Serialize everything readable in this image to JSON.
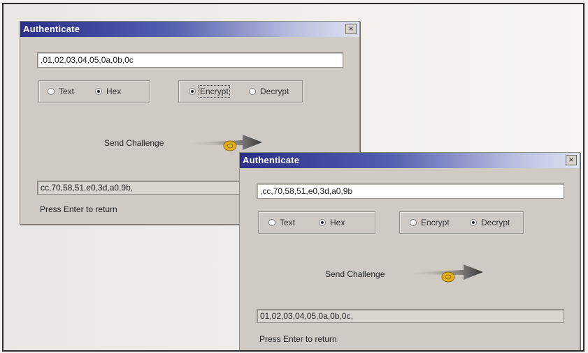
{
  "dialog_back": {
    "title": "Authenticate",
    "close_label": "×",
    "input_value": ",01,02,03,04,05,0a,0b,0c",
    "format_group": {
      "text_label": "Text",
      "hex_label": "Hex",
      "selected": "Hex"
    },
    "mode_group": {
      "encrypt_label": "Encrypt",
      "decrypt_label": "Decrypt",
      "selected": "Encrypt"
    },
    "send_label": "Send Challenge",
    "response_value": "cc,70,58,51,e0,3d,a0,9b,",
    "status": "Press Enter to return"
  },
  "dialog_front": {
    "title": "Authenticate",
    "close_label": "×",
    "input_value": ",cc,70,58,51,e0,3d,a0,9b",
    "format_group": {
      "text_label": "Text",
      "hex_label": "Hex",
      "selected": "Hex"
    },
    "mode_group": {
      "encrypt_label": "Encrypt",
      "decrypt_label": "Decrypt",
      "selected": "Decrypt"
    },
    "send_label": "Send Challenge",
    "response_value": "01,02,03,04,05,0a,0b,0c,",
    "status": "Press Enter to return"
  },
  "colors": {
    "titlebar_start": "#2b2f8a",
    "dialog_face": "#cfcbc4",
    "arrow": "#333333",
    "coin": "#e6b21c"
  },
  "icons": [
    "close-icon",
    "send-arrow-icon",
    "coin-icon"
  ]
}
